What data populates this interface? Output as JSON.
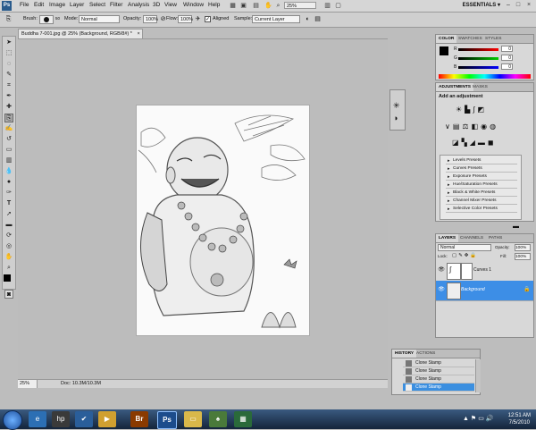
{
  "menubar": {
    "app_logo": "Ps",
    "items": [
      "File",
      "Edit",
      "Image",
      "Layer",
      "Select",
      "Filter",
      "Analysis",
      "3D",
      "View",
      "Window",
      "Help"
    ],
    "zoom": "25%",
    "workspace": "ESSENTIALS ▾",
    "window_buttons": [
      "–",
      "□",
      "×"
    ]
  },
  "options": {
    "brush_label": "Brush:",
    "brush_size": "50",
    "mode_label": "Mode:",
    "mode_value": "Normal",
    "opacity_label": "Opacity:",
    "opacity_value": "100%",
    "flow_label": "Flow:",
    "flow_value": "100%",
    "aligned_label": "Aligned",
    "aligned_checked": "✓",
    "sample_label": "Sample:",
    "sample_value": "Current Layer"
  },
  "document": {
    "tab_title": "Buddha 7-001.jpg @ 25% (Background, RGB/8#) *",
    "tab_close": "×",
    "zoom": "25%",
    "doc_info": "Doc: 10.3M/10.3M"
  },
  "color_panel": {
    "tabs": [
      "COLOR",
      "SWATCHES",
      "STYLES"
    ],
    "channels": [
      {
        "label": "R",
        "value": "0"
      },
      {
        "label": "G",
        "value": "0"
      },
      {
        "label": "B",
        "value": "0"
      }
    ],
    "fg_color": "#000000",
    "bg_color": "#ffffff"
  },
  "adjustments_panel": {
    "tabs": [
      "ADJUSTMENTS",
      "MASKS"
    ],
    "heading": "Add an adjustment",
    "presets": [
      "Levels Presets",
      "Curves Presets",
      "Exposure Presets",
      "Hue/Saturation Presets",
      "Black & White Presets",
      "Channel Mixer Presets",
      "Selective Color Presets"
    ]
  },
  "layers_panel": {
    "tabs": [
      "LAYERS",
      "CHANNELS",
      "PATHS"
    ],
    "blend_mode": "Normal",
    "opacity_label": "Opacity:",
    "opacity_value": "100%",
    "lock_label": "Lock:",
    "fill_label": "Fill:",
    "fill_value": "100%",
    "layers": [
      {
        "name": "Curves 1",
        "selected": false
      },
      {
        "name": "Background",
        "selected": true
      }
    ]
  },
  "history_panel": {
    "tabs": [
      "HISTORY",
      "ACTIONS"
    ],
    "items": [
      "Clone Stamp",
      "Clone Stamp",
      "Clone Stamp",
      "Clone Stamp"
    ]
  },
  "taskbar": {
    "time": "12:51 AM",
    "date": "7/5/2010"
  },
  "colors": {
    "accent": "#3b8fe0",
    "selected_layer": "#3d8ee6"
  }
}
